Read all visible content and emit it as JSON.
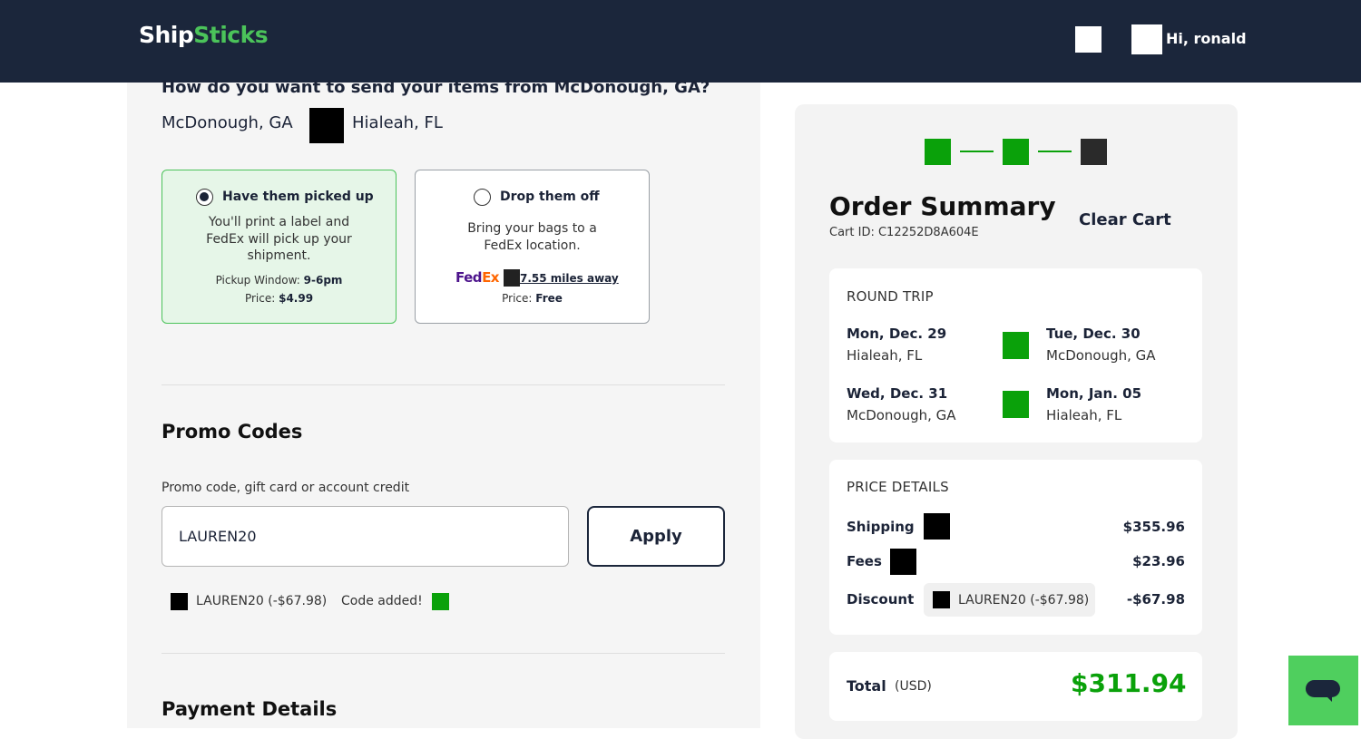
{
  "header": {
    "logo_part1": "Ship",
    "logo_part2": "Sticks",
    "greeting": "Hi, ronald"
  },
  "shipping": {
    "question": "How do you want to send your items from McDonough, GA?",
    "from": "McDonough, GA",
    "to": "Hialeah, FL",
    "options": [
      {
        "title": "Have them picked up",
        "description": "You'll print a label and FedEx will pick up your shipment.",
        "window_label": "Pickup Window:",
        "window_value": "9-6pm",
        "price_label": "Price:",
        "price_value": "$4.99",
        "selected": true
      },
      {
        "title": "Drop them off",
        "description": "Bring your bags to a FedEx location.",
        "fedex_a": "Fed",
        "fedex_b": "Ex",
        "distance": "7.55 miles away",
        "price_label": "Price:",
        "price_value": "Free",
        "selected": false
      }
    ]
  },
  "promo": {
    "heading": "Promo Codes",
    "label": "Promo code, gift card or account credit",
    "input_value": "LAUREN20",
    "apply_label": "Apply",
    "applied_code": "LAUREN20 (-$67.98)",
    "added_text": "Code added!"
  },
  "payment": {
    "heading": "Payment Details"
  },
  "summary": {
    "title": "Order Summary",
    "cart_id": "Cart ID: C12252D8A604E",
    "clear_cart": "Clear Cart",
    "trip_type": "ROUND TRIP",
    "legs": [
      {
        "from_date": "Mon, Dec. 29",
        "from_city": "Hialeah, FL",
        "to_date": "Tue, Dec. 30",
        "to_city": "McDonough, GA"
      },
      {
        "from_date": "Wed, Dec. 31",
        "from_city": "McDonough, GA",
        "to_date": "Mon, Jan. 05",
        "to_city": "Hialeah, FL"
      }
    ],
    "price_details_heading": "PRICE DETAILS",
    "shipping_label": "Shipping",
    "shipping_value": "$355.96",
    "fees_label": "Fees",
    "fees_value": "$23.96",
    "discount_label": "Discount",
    "discount_code": "LAUREN20 (-$67.98)",
    "discount_value": "-$67.98",
    "total_label": "Total",
    "total_currency": "(USD)",
    "total_value": "$311.94"
  },
  "colors": {
    "header_bg": "#1b263b",
    "brand_green": "#4bc35a",
    "accent_green": "#0aa10a",
    "selected_bg": "#e6f6e8"
  },
  "icons": [
    "arrow-right-icon",
    "fedex-logo",
    "chat-icon",
    "info-icon",
    "check-icon",
    "remove-icon",
    "user-icon",
    "cart-icon"
  ]
}
